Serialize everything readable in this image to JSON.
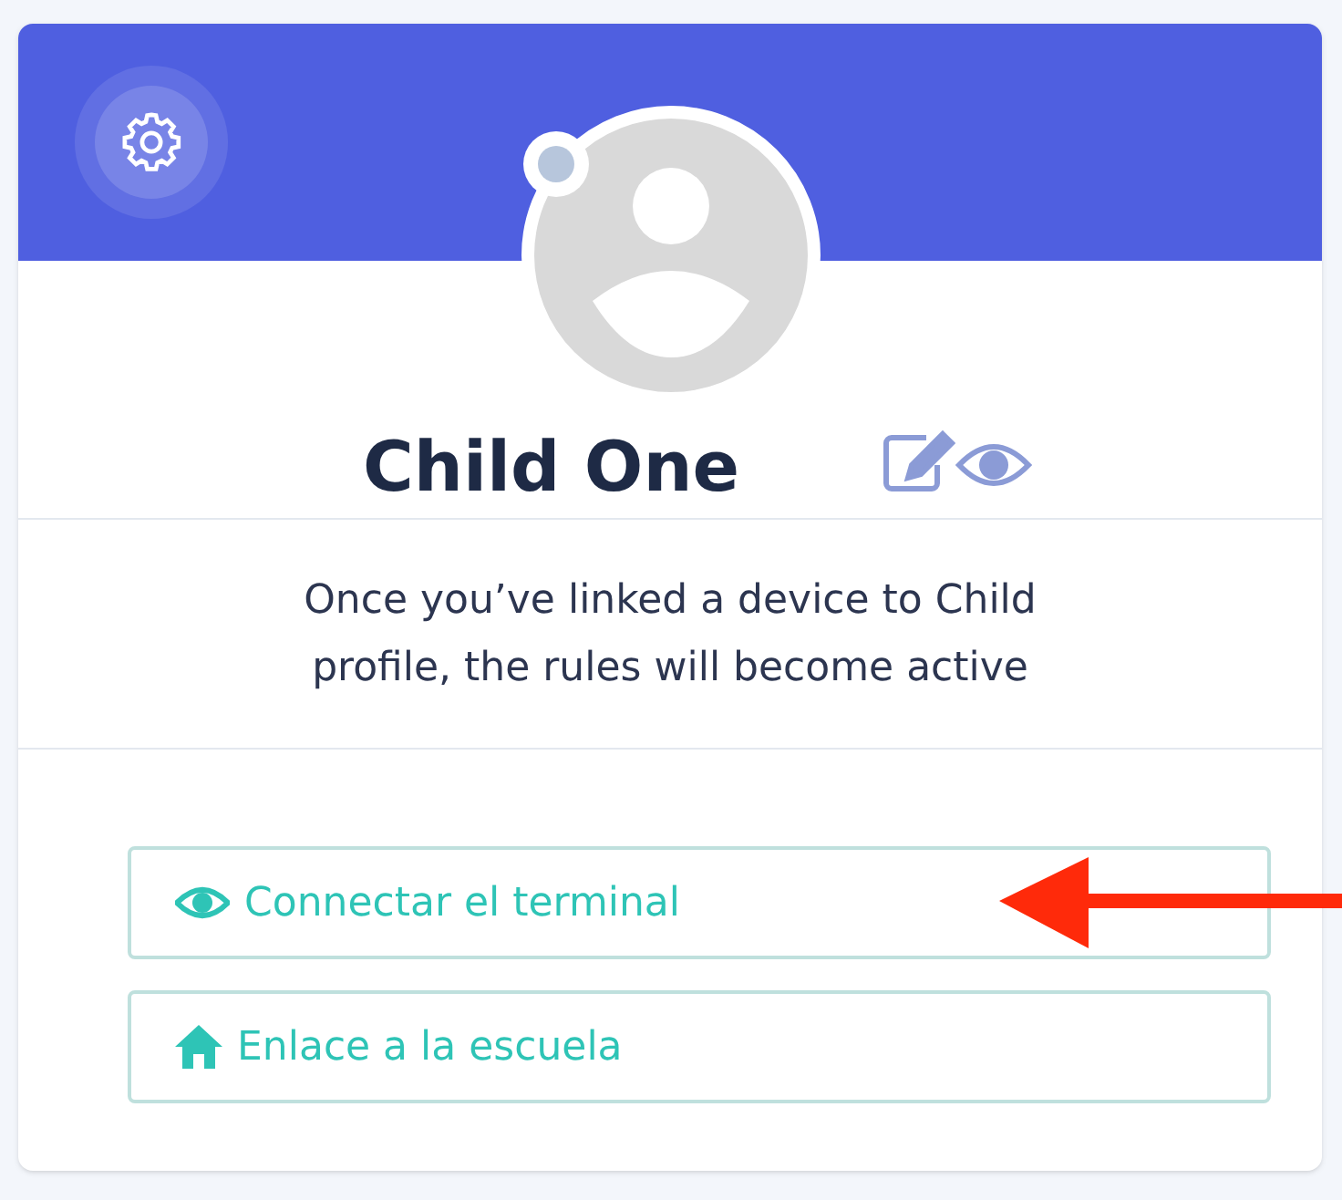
{
  "profile": {
    "name": "Child One"
  },
  "notice": "Once you’ve linked a device to Child profile, the rules will become active",
  "actions": [
    {
      "kind": "eye",
      "label": "Connectar el terminal"
    },
    {
      "kind": "home",
      "label": "Enlace a la escuela"
    }
  ]
}
